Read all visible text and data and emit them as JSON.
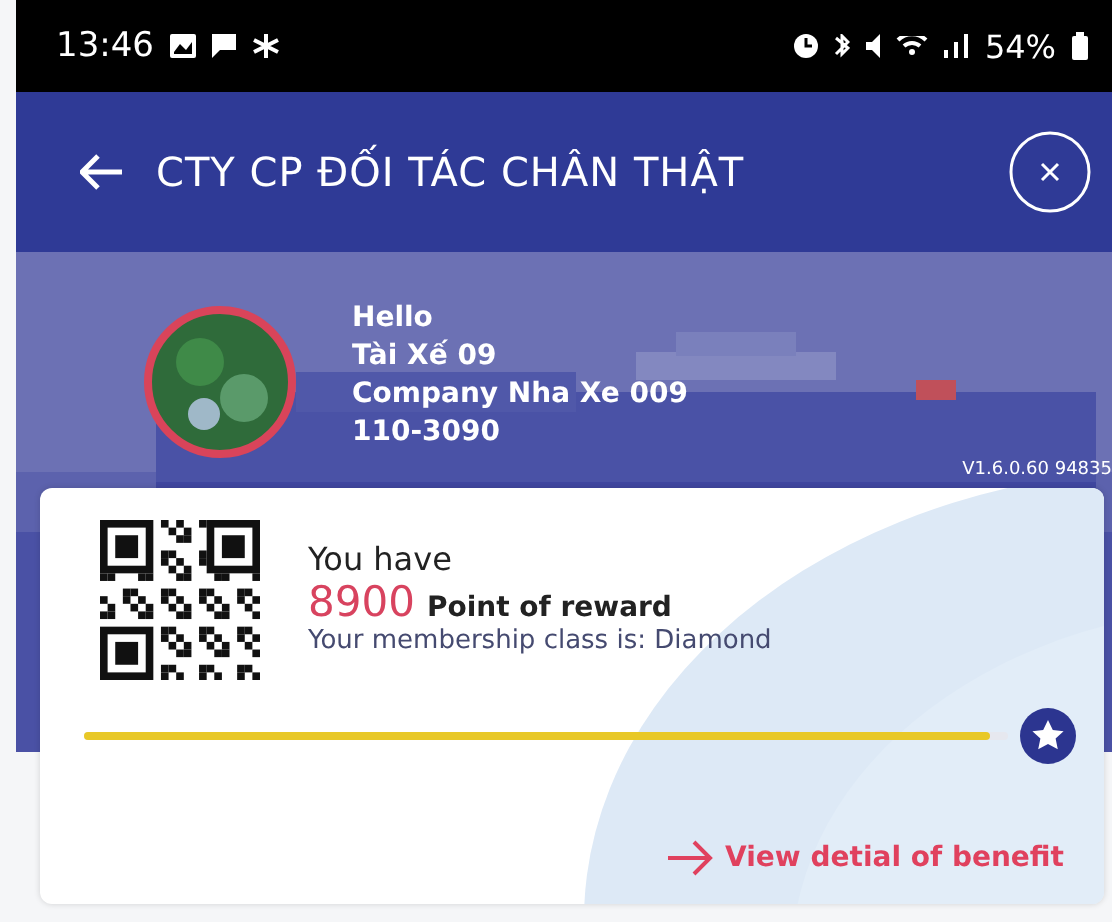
{
  "status_bar": {
    "time": "13:46",
    "battery": "54%"
  },
  "header": {
    "title": "CTY CP ĐỐI TÁC CHÂN THẬT"
  },
  "profile": {
    "greeting": "Hello",
    "name": "Tài Xế 09",
    "company": "Company Nha Xe 009",
    "code": "110-3090",
    "version": "V1.6.0.60 94835"
  },
  "reward": {
    "intro": "You have",
    "points": "8900",
    "points_label": "Point of reward",
    "membership": "Your membership class is: Diamond",
    "level": 0.98,
    "link": "View detial of benefit"
  }
}
